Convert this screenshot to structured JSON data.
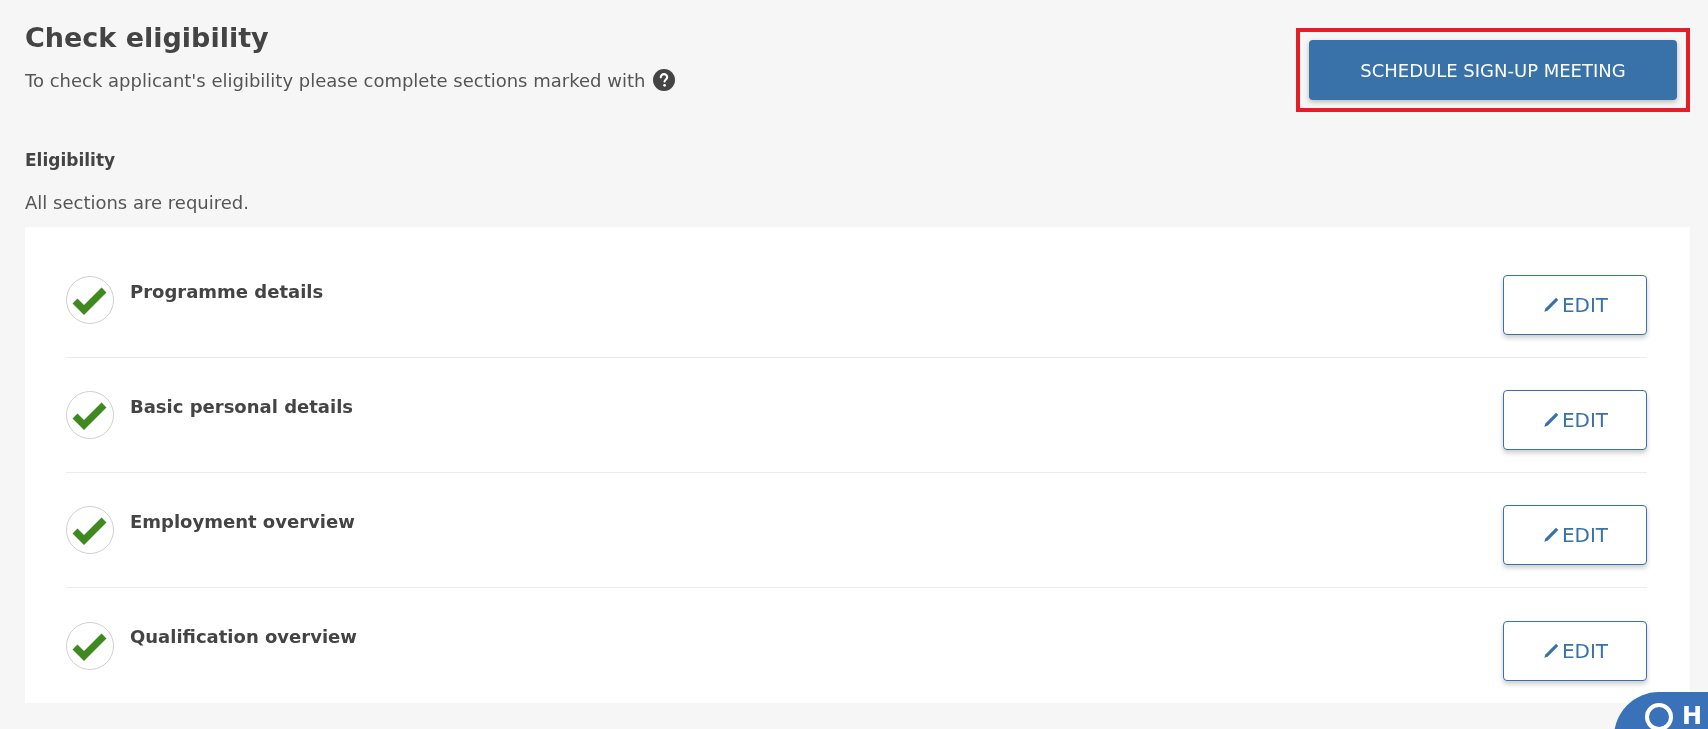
{
  "header": {
    "title": "Check eligibility",
    "subtitle": "To check applicant's eligibility please complete sections marked with"
  },
  "action_button": {
    "label": "SCHEDULE SIGN-UP MEETING",
    "highlighted": true
  },
  "section": {
    "title": "Eligibility",
    "note": "All sections are required."
  },
  "items": [
    {
      "label": "Programme details",
      "completed": true,
      "button": "EDIT"
    },
    {
      "label": "Basic personal details",
      "completed": true,
      "button": "EDIT"
    },
    {
      "label": "Employment overview",
      "completed": true,
      "button": "EDIT"
    },
    {
      "label": "Qualification overview",
      "completed": true,
      "button": "EDIT"
    }
  ],
  "help_widget": {
    "label": "H"
  }
}
